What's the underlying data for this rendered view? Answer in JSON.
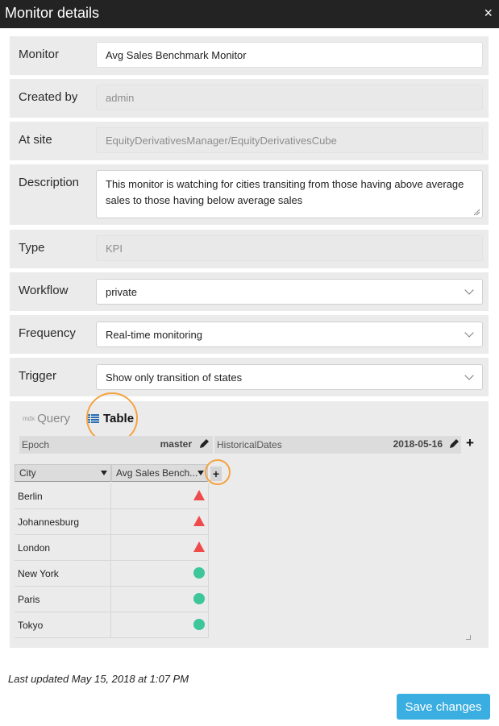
{
  "dialog": {
    "title": "Monitor details",
    "close_glyph": "×"
  },
  "fields": {
    "monitor": {
      "label": "Monitor",
      "value": "Avg Sales Benchmark Monitor"
    },
    "created_by": {
      "label": "Created by",
      "value": "admin"
    },
    "at_site": {
      "label": "At site",
      "value": "EquityDerivativesManager/EquityDerivativesCube"
    },
    "description": {
      "label": "Description",
      "value": "This monitor is watching for cities transiting from those having above average sales to those having below average sales"
    },
    "type": {
      "label": "Type",
      "value": "KPI"
    },
    "workflow": {
      "label": "Workflow",
      "value": "private"
    },
    "frequency": {
      "label": "Frequency",
      "value": "Real-time monitoring"
    },
    "trigger": {
      "label": "Trigger",
      "value": "Show only transition of states"
    }
  },
  "tabs": {
    "query_prefix": "mdx",
    "query_label": "Query",
    "table_label": "Table"
  },
  "axes": {
    "epoch": {
      "name": "Epoch",
      "value": "master"
    },
    "historical": {
      "name": "HistoricalDates",
      "value": "2018-05-16"
    },
    "add_glyph": "+"
  },
  "table": {
    "columns": [
      "City",
      "Avg Sales Bench..."
    ],
    "add_column_glyph": "+",
    "rows": [
      {
        "city": "Berlin",
        "status": "above-average",
        "icon": "red-triangle-icon"
      },
      {
        "city": "Johannesburg",
        "status": "above-average",
        "icon": "red-triangle-icon"
      },
      {
        "city": "London",
        "status": "above-average",
        "icon": "red-triangle-icon"
      },
      {
        "city": "New York",
        "status": "below-average",
        "icon": "green-circle-icon"
      },
      {
        "city": "Paris",
        "status": "below-average",
        "icon": "green-circle-icon"
      },
      {
        "city": "Tokyo",
        "status": "below-average",
        "icon": "green-circle-icon"
      }
    ]
  },
  "footer": {
    "last_updated": "Last updated May 15, 2018 at 1:07 PM",
    "save_label": "Save changes"
  },
  "colors": {
    "accent": "#3aaee0",
    "highlight_ring": "#f4a341",
    "triangle_red": "#f04b4b",
    "circle_green": "#3cc69a",
    "titlebar": "#232323"
  }
}
